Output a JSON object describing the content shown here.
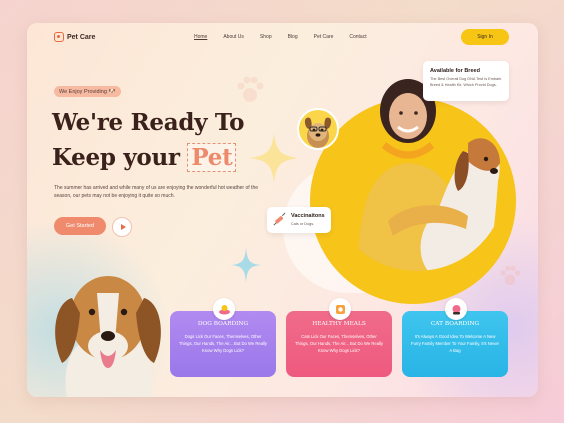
{
  "nav": {
    "brand": "Pet Care",
    "links": [
      "Home",
      "About Us",
      "Shop",
      "Blog",
      "Pet Care",
      "Contact"
    ],
    "signin": "Sign In"
  },
  "hero": {
    "pill": "We Enjoy Providing",
    "line1": "We're Ready To",
    "line2_prefix": "Keep your",
    "line2_highlight": "Pet",
    "description": "The summer has arrived and while many of us are enjoying the wonderful hot weather of the season, our pets may not be enjoying it quite so much.",
    "cta": "Get Started"
  },
  "badges": {
    "breed_title": "Available for Breed",
    "breed_text": "The Best Overall Dog DNA Test Is Embark Breed & Health Kit, Which Provid Dogs.",
    "vacc_title": "Vaccinaitons",
    "vacc_text": "Cats or Dogs."
  },
  "services": [
    {
      "title": "DOG BOARDING",
      "text": "Dogs Lick Our Faces, Themselves, Other Things, Our Hands, The Air... But Do We Really Know Why Dogs Lick?",
      "icon": "dog-bed-icon"
    },
    {
      "title": "HEALTHY MEALS",
      "text": "Cats Lick Our Faces, Themselves, Other Things, Our Hands, The Air... But Do We Really Know Why Dogs Lick?",
      "icon": "pet-food-icon"
    },
    {
      "title": "CAT BOARDING",
      "text": "It's Always A Good Idea To Welcome A New Furry Family Member To Your Family, It's Never A Bag",
      "icon": "cat-bowl-icon"
    }
  ],
  "colors": {
    "accent": "#f08a6c",
    "signin": "#f7c514",
    "heading": "#3b211b",
    "svc_purple": "#a67ff0",
    "svc_pink": "#ef6385",
    "svc_blue": "#33bdea"
  }
}
